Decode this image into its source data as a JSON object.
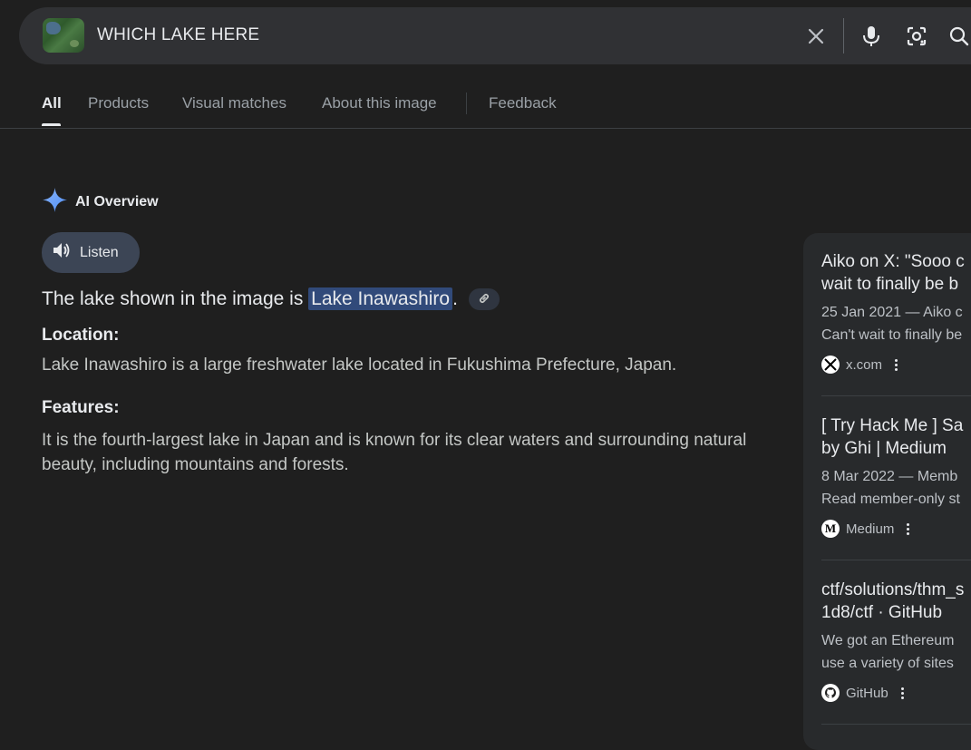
{
  "search": {
    "query": "WHICH LAKE HERE",
    "icons": [
      "image-thumbnail",
      "clear-icon",
      "mic-icon",
      "lens-icon",
      "search-icon"
    ]
  },
  "tabs": [
    {
      "label": "All",
      "active": true
    },
    {
      "label": "Products"
    },
    {
      "label": "Visual matches"
    },
    {
      "label": "About this image"
    },
    {
      "label": "Feedback"
    }
  ],
  "ai_overview": {
    "title": "AI Overview",
    "listen_label": "Listen",
    "answer_prefix": "The lake shown in the image is ",
    "answer_highlight": "Lake Inawashiro",
    "answer_suffix": ".",
    "location_heading": "Location:",
    "location_text": "Lake Inawashiro is a large freshwater lake located in Fukushima Prefecture, Japan.",
    "features_heading": "Features:",
    "features_text": "It is the fourth-largest lake in Japan and is known for its clear waters and surrounding natural beauty, including mountains and forests."
  },
  "sources": [
    {
      "title_line1": "Aiko on X: \"Sooo c",
      "title_line2": "wait to finally be b",
      "snippet_line1": "25 Jan 2021 — Aiko c",
      "snippet_line2": "Can't wait to finally be",
      "site": "x.com",
      "favicon": "X"
    },
    {
      "title_line1": "[ Try Hack Me ] Sa",
      "title_line2": "by Ghi | Medium",
      "snippet_line1": "8 Mar 2022 — Memb",
      "snippet_line2": "Read member-only st",
      "site": "Medium",
      "favicon": "M"
    },
    {
      "title_line1": "ctf/solutions/thm_s",
      "title_line2": "1d8/ctf · GitHub",
      "snippet_line1": "We got an Ethereum",
      "snippet_line2": "use a variety of sites",
      "site": "GitHub",
      "favicon": "github-icon"
    }
  ],
  "colors": {
    "background": "#1f1f1f",
    "search_bar": "#303134",
    "highlight": "#314a7a",
    "accent_blue": "#8ab4f8"
  }
}
